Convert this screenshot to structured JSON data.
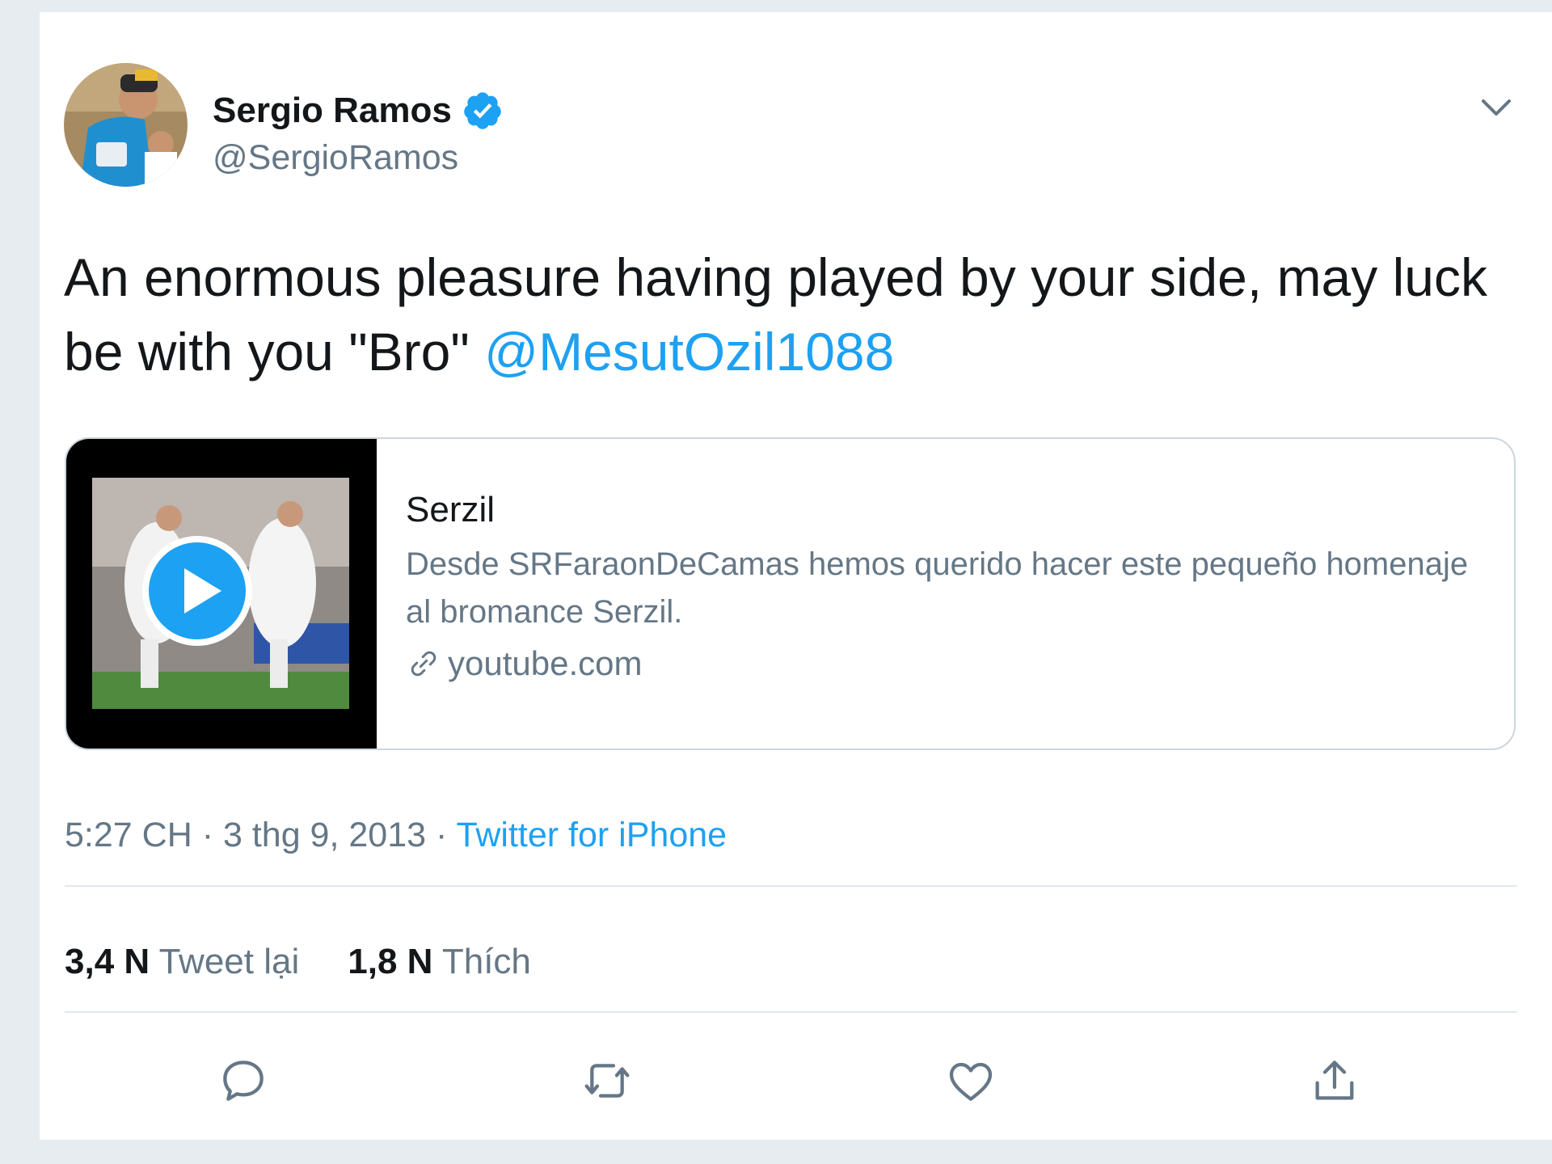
{
  "tweet": {
    "author_name": "Sergio Ramos",
    "author_handle": "@SergioRamos",
    "text_main": "An enormous pleasure having played by your side, may luck be with you \"Bro\" ",
    "mention": "@MesutOzil1088",
    "link_card": {
      "title": "Serzil",
      "description": "Desde SRFaraonDeCamas hemos querido hacer este pequeño homenaje al bromance Serzil.",
      "domain": "youtube.com"
    },
    "time": "5:27 CH",
    "date": "3 thg 9, 2013",
    "source": "Twitter for iPhone",
    "retweets_count": "3,4 N",
    "retweets_label": "Tweet lại",
    "likes_count": "1,8 N",
    "likes_label": "Thích"
  },
  "icons": {
    "verified": "verified-badge-icon",
    "chevron": "chevron-down-icon",
    "link": "link-icon",
    "play": "play-icon",
    "reply": "reply-icon",
    "retweet": "retweet-icon",
    "like": "heart-icon",
    "share": "share-icon"
  },
  "colors": {
    "accent": "#1da1f2",
    "text": "#14171a",
    "muted": "#657786",
    "border": "#ccd6dd"
  }
}
